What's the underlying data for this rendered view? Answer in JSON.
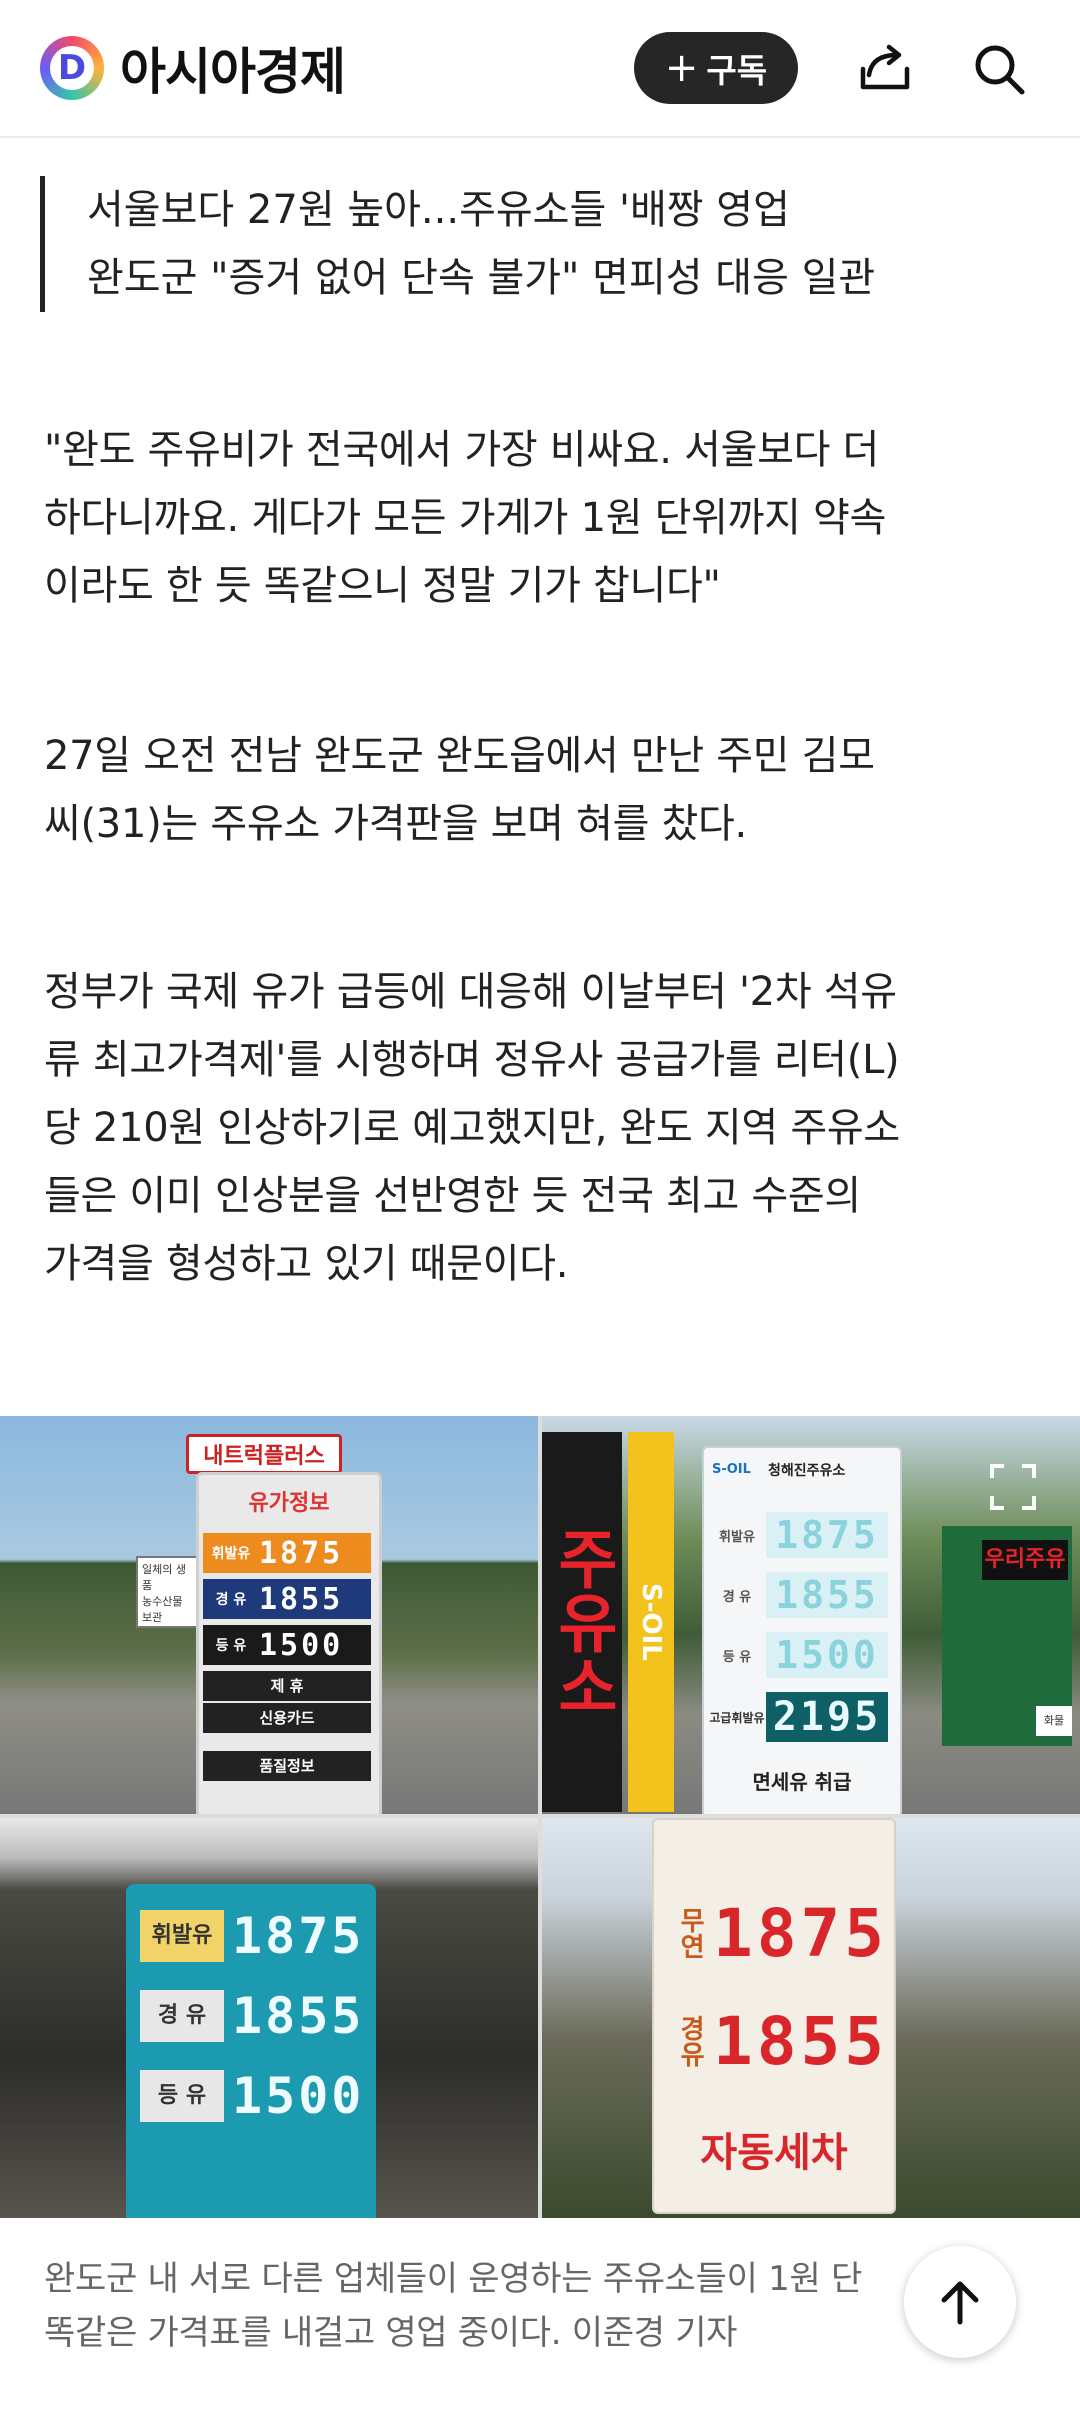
{
  "header": {
    "logo_letter": "D",
    "logo_text": "아시아경제",
    "subscribe_plus": "+",
    "subscribe_label": "구독"
  },
  "subheadings": [
    "서울보다 27원 높아...주유소들 '배짱 영업",
    "완도군 \"증거 없어 단속 불가\" 면피성 대응 일관"
  ],
  "paragraphs": [
    [
      "\"완도 주유비가 전국에서 가장 비싸요. 서울보다 더",
      "하다니까요. 게다가 모든 가게가 1원 단위까지 약속",
      "이라도 한 듯 똑같으니 정말 기가 찹니다\""
    ],
    [
      "27일 오전 전남 완도군 완도읍에서 만난 주민 김모",
      "씨(31)는 주유소 가격판을 보며 혀를 찼다."
    ],
    [
      "정부가 국제 유가 급등에 대응해 이날부터 '2차 석유",
      "류 최고가격제'를 시행하며 정유사 공급가를 리터(L)",
      "당 210원 인상하기로 예고했지만, 완도 지역 주유소",
      "들은 이미 인상분을 선반영한 듯 전국 최고 수준의",
      "가격을 형성하고 있기 때문이다."
    ]
  ],
  "photo": {
    "panel1": {
      "banner": "내트럭플러스",
      "title": "유가정보",
      "rows": [
        {
          "label": "휘발유",
          "price": "1875"
        },
        {
          "label": "경 유",
          "price": "1855"
        },
        {
          "label": "등 유",
          "price": "1500"
        }
      ],
      "extra1": "제 휴",
      "extra2": "신용카드",
      "extra3": "품질정보",
      "side_sign_1": "일체의 생품",
      "side_sign_2": "농수산물 보관"
    },
    "panel2": {
      "vertical_red": "주유소",
      "vertical_brand": "S-OIL",
      "brand": "S-OIL",
      "station_name": "청해진주유소",
      "rows": [
        {
          "label": "휘발유",
          "price": "1875"
        },
        {
          "label": "경 유",
          "price": "1855"
        },
        {
          "label": "등 유",
          "price": "1500"
        },
        {
          "label": "고급휘발유",
          "price": "2195"
        }
      ],
      "bottom_text": "면세유 취급",
      "side_sign": "우리주유",
      "side_sign_2": "화물"
    },
    "panel3": {
      "rows": [
        {
          "label": "휘발유",
          "price": "1875"
        },
        {
          "label": "경 유",
          "price": "1855"
        },
        {
          "label": "등 유",
          "price": "1500"
        }
      ]
    },
    "panel4": {
      "rows": [
        {
          "label": "무연",
          "price": "1875"
        },
        {
          "label": "경유",
          "price": "1855"
        }
      ],
      "bottom": "자동세차"
    }
  },
  "caption": [
    "완도군 내 서로 다른 업체들이 운영하는 주유소들이 1원 단",
    "똑같은 가격표를 내걸고 영업 중이다. 이준경 기자"
  ],
  "colors": {
    "accent_dark": "#262626",
    "caption": "#666666",
    "orange_sign": "#f0a020",
    "navy_sign": "#1f3a7a",
    "teal_sign": "#1c9bb0",
    "red_digits": "#d8262b"
  }
}
